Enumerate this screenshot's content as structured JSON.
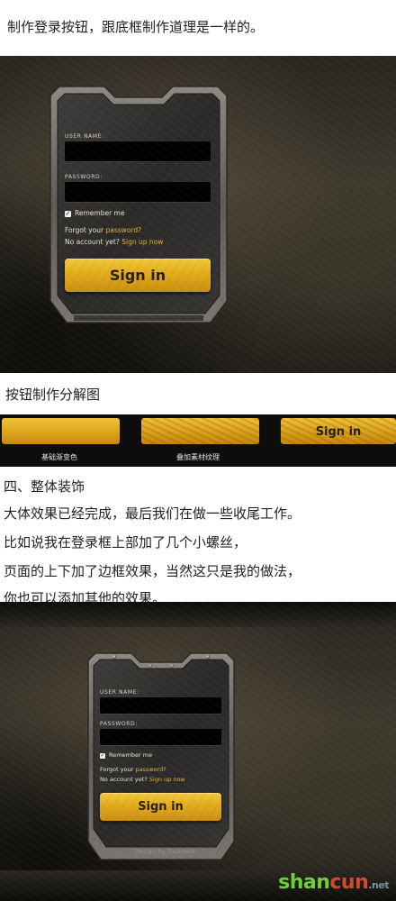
{
  "intro_line": "制作登录按钮，跟底框制作道理是一样的。",
  "login1": {
    "username_label": "USER NAME:",
    "password_label": "PASSWORD:",
    "remember_label": "Remember me",
    "forgot_prefix": "Forgot your ",
    "forgot_link": "password?",
    "no_account_prefix": "No account yet? ",
    "signup_link": "Sign up now",
    "sign_in_label": "Sign in"
  },
  "breakdown_title": "按钮制作分解图",
  "breakdown": {
    "caption1": "基础渐变色",
    "caption2": "叠加素材纹理",
    "button_partial": "Sign in"
  },
  "section4": {
    "heading": "四、整体装饰",
    "line1": "大体效果已经完成，最后我们在做一些收尾工作。",
    "line2": "比如说我在登录框上部加了几个小螺丝，",
    "line3": "页面的上下加了边框效果，当然这只是我的做法，",
    "line4": "你也可以添加其他的效果。"
  },
  "login2": {
    "username_label": "USER NAME:",
    "password_label": "PASSWORD:",
    "remember_label": "Remember me",
    "forgot_prefix": "Forgot your ",
    "forgot_link": "password?",
    "no_account_prefix": "No account yet? ",
    "signup_link": "Sign up now",
    "sign_in_label": "Sign in",
    "design_credit": "Design by DearSalt"
  },
  "watermark": {
    "part1": "shan",
    "part2": "cun",
    "part3": ".net"
  },
  "colors": {
    "accent_gold": "#e2ab1b",
    "link_gold": "#e3b53a",
    "field_black": "#000000"
  }
}
